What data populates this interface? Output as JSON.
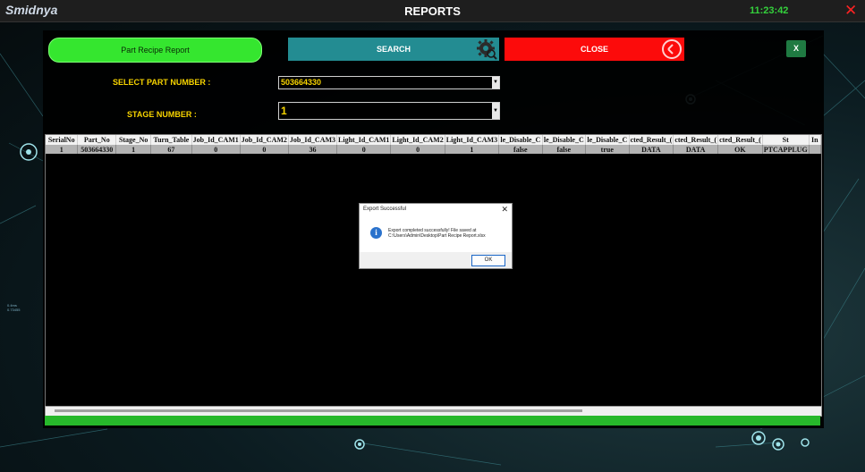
{
  "window": {
    "logo": "Smidnya",
    "title": "REPORTS",
    "clock": "11:23:42",
    "close_glyph": "✕"
  },
  "toolbar": {
    "report_label": "Part Recipe Report",
    "search_label": "SEARCH",
    "close_label": "CLOSE",
    "excel_label": "X"
  },
  "form": {
    "part_number_label": "SELECT PART NUMBER :",
    "part_number_value": "503664330",
    "stage_number_label": "STAGE NUMBER :",
    "stage_number_value": "1"
  },
  "table": {
    "columns": [
      "SerialNo",
      "Part_No",
      "Stage_No",
      "Turn_Table",
      "Job_Id_CAM1",
      "Job_Id_CAM2",
      "Job_Id_CAM3",
      "Light_Id_CAM1",
      "Light_Id_CAM2",
      "Light_Id_CAM3",
      "le_Disable_C",
      "le_Disable_C",
      "le_Disable_C",
      "cted_Result_(",
      "cted_Result_(",
      "cted_Result_(",
      "St",
      "In"
    ],
    "rows": [
      [
        "1",
        "503664330",
        "1",
        "67",
        "0",
        "0",
        "36",
        "0",
        "0",
        "1",
        "false",
        "false",
        "true",
        "DATA",
        "DATA",
        "OK",
        "PTCAPPLUG",
        ""
      ]
    ]
  },
  "dialog": {
    "title": "Export Successful",
    "close_glyph": "✕",
    "message_line1": "Export completed successfully! File saved at",
    "message_line2": "C:\\Users\\Admin\\Desktop\\Part Recipe Report.xlsx",
    "ok_label": "OK",
    "info_glyph": "i"
  },
  "background": {
    "side_label_1": "0.4ms",
    "side_label_2": "0.73455"
  },
  "colors": {
    "report_button": "#35e62f",
    "search_button": "#238c92",
    "close_button": "#fc0b0b",
    "label_text": "#f7d400",
    "clock": "#34d13c",
    "status_bar": "#27b82b"
  },
  "icons": {
    "search": "gear-search-icon",
    "close": "circle-close-icon",
    "excel": "excel-icon",
    "info": "info-icon"
  }
}
